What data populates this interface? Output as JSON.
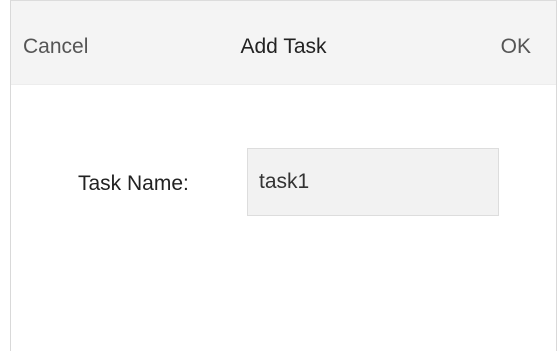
{
  "dialog": {
    "title": "Add Task",
    "cancel_label": "Cancel",
    "ok_label": "OK"
  },
  "form": {
    "task_name_label": "Task Name:",
    "task_name_value": "task1"
  }
}
